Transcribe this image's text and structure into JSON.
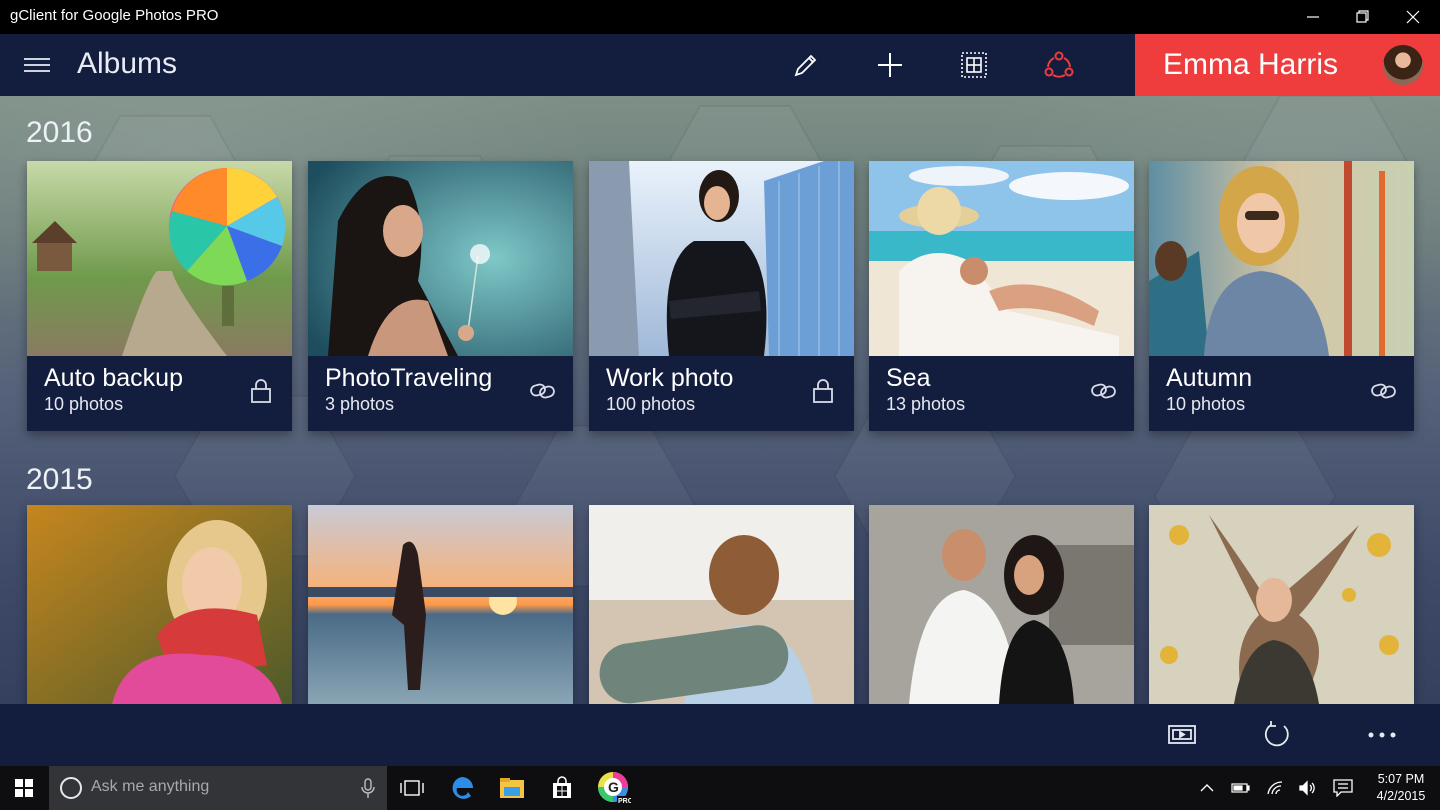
{
  "window": {
    "title": "gClient for Google Photos PRO",
    "controls": {
      "minimize": "minimize-icon",
      "maximize": "restore-icon",
      "close": "close-icon"
    }
  },
  "header": {
    "page_title": "Albums",
    "actions": [
      "pencil-icon",
      "plus-icon",
      "select-grid-icon",
      "share-icon"
    ],
    "user_name": "Emma Harris",
    "accent_color": "#ef3c3c",
    "bar_color": "#131d3d"
  },
  "sections": [
    {
      "year": "2016",
      "albums": [
        {
          "name": "Auto backup",
          "count": "10 photos",
          "status_icon": "lock-icon"
        },
        {
          "name": "PhotoTraveling",
          "count": "3 photos",
          "status_icon": "link-icon"
        },
        {
          "name": "Work photo",
          "count": "100 photos",
          "status_icon": "lock-icon"
        },
        {
          "name": "Sea",
          "count": "13 photos",
          "status_icon": "link-icon"
        },
        {
          "name": "Autumn",
          "count": "10 photos",
          "status_icon": "link-icon"
        }
      ]
    },
    {
      "year": "2015",
      "albums": [
        {
          "name": "",
          "count": ""
        },
        {
          "name": "",
          "count": ""
        },
        {
          "name": "",
          "count": ""
        },
        {
          "name": "",
          "count": ""
        },
        {
          "name": "",
          "count": ""
        }
      ]
    }
  ],
  "commandbar": {
    "actions": [
      "slideshow-icon",
      "refresh-icon",
      "more-icon"
    ],
    "more_label": "..."
  },
  "taskbar": {
    "search_placeholder": "Ask me anything",
    "apps": [
      "task-view-icon",
      "edge-icon",
      "file-explorer-icon",
      "store-icon",
      "gclient-icon"
    ],
    "tray": [
      "chevron-up-icon",
      "battery-icon",
      "wifi-icon",
      "volume-icon",
      "notification-icon"
    ],
    "time": "5:07 PM",
    "date": "4/2/2015"
  }
}
